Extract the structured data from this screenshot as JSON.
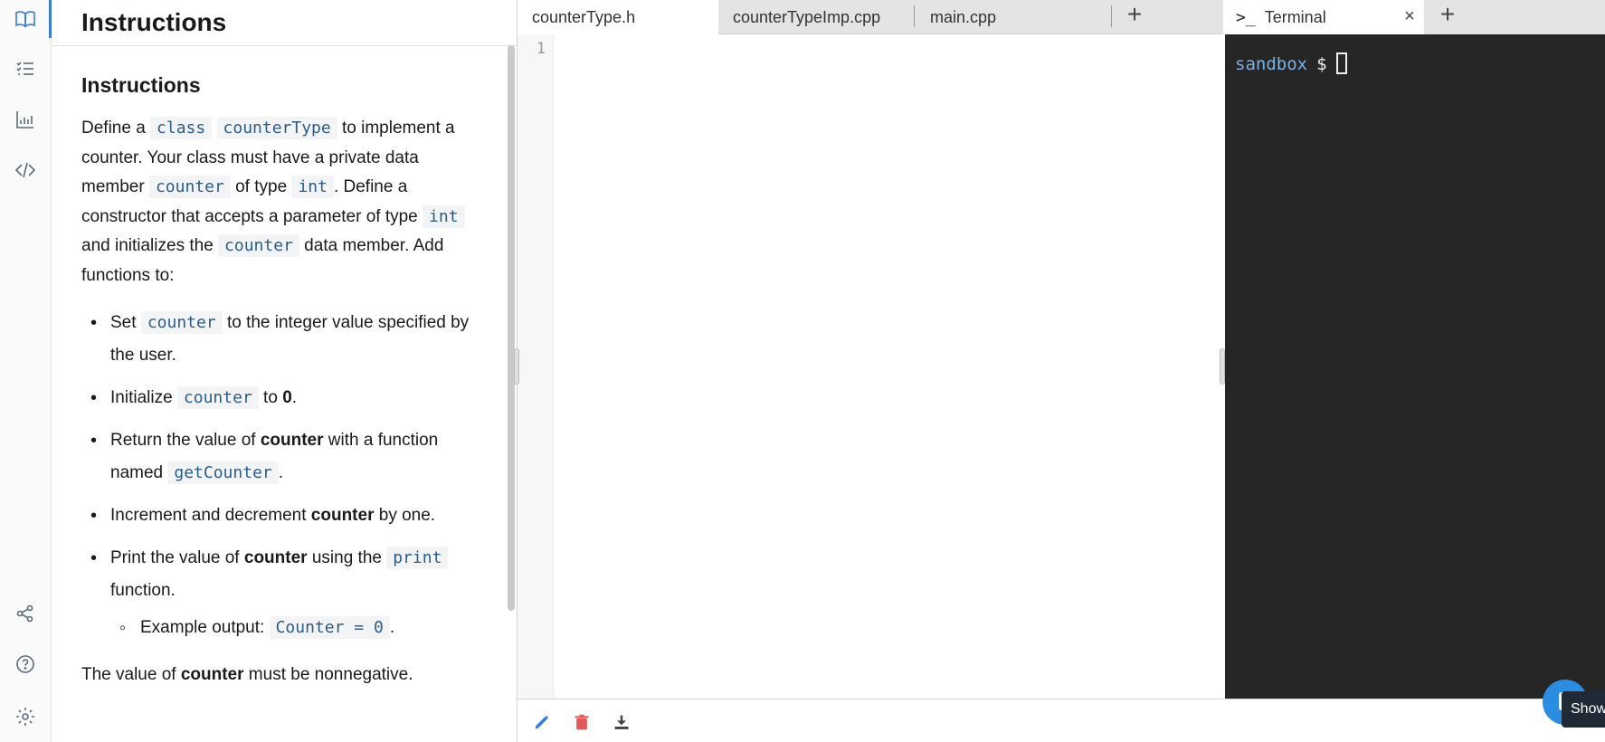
{
  "rail": {
    "top_icons": [
      "book-icon",
      "checklist-icon",
      "bar-chart-icon",
      "code-icon"
    ],
    "bottom_icons": [
      "share-icon",
      "help-icon",
      "settings-icon"
    ]
  },
  "instructions": {
    "header_title": "Instructions",
    "section_title": "Instructions",
    "p1": {
      "t1": "Define a ",
      "c1": "class",
      "c2": "counterType",
      "t2": " to implement a counter. Your class must have a private data member ",
      "c3": "counter",
      "t3": " of type ",
      "c4": "int",
      "t4": ". Define a constructor that accepts a parameter of type ",
      "c5": "int",
      "t5": " and initializes the ",
      "c6": "counter",
      "t6": " data member. Add functions to:"
    },
    "bullets": {
      "b1": {
        "t1": "Set ",
        "c1": "counter",
        "t2": " to the integer value specified by the user."
      },
      "b2": {
        "t1": "Initialize ",
        "c1": "counter",
        "t2": " to ",
        "b1": "0",
        "t3": "."
      },
      "b3": {
        "t1": "Return the value of ",
        "b1": "counter",
        "t2": " with a function named ",
        "c1": "getCounter",
        "t3": "."
      },
      "b4": {
        "t1": "Increment and decrement ",
        "b1": "counter",
        "t2": " by one."
      },
      "b5": {
        "t1": "Print the value of ",
        "b1": "counter",
        "t2": " using the ",
        "c1": "print",
        "t3": " function."
      },
      "b5a": {
        "t1": "Example output: ",
        "c1": "Counter = 0",
        "t2": "."
      }
    },
    "last": {
      "t1": "The value of ",
      "b1": "counter",
      "t2": " must be nonnegative."
    }
  },
  "editor": {
    "tabs": [
      "counterType.h",
      "counterTypeImp.cpp",
      "main.cpp"
    ],
    "active_tab": "counterType.h",
    "add_tab": "+",
    "line_numbers": [
      "1"
    ],
    "footer_icons": [
      "pencil-icon",
      "trash-icon",
      "download-icon"
    ]
  },
  "terminal": {
    "tab_prompt_icon": ">_",
    "tab_label": "Terminal",
    "close": "×",
    "add_tab": "+",
    "host": "sandbox",
    "prompt": "$"
  },
  "show_button": "Show",
  "colors": {
    "accent": "#3a7bd5",
    "code_text": "#2c5d8a",
    "terminal_bg": "#262626",
    "terminal_host": "#7ab0e0",
    "trash": "#e05a5a",
    "pencil": "#3a7bd5"
  }
}
